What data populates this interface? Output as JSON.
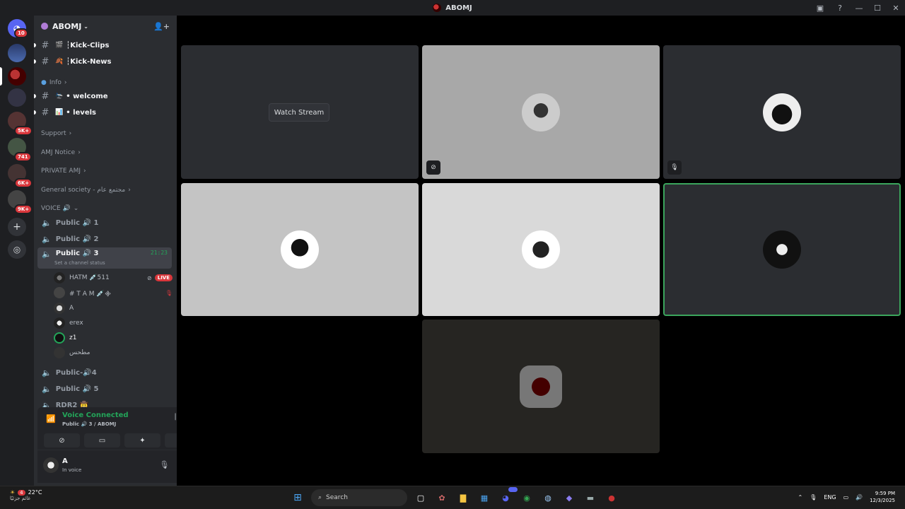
{
  "window": {
    "title": "ABOMJ"
  },
  "guilds": {
    "home_badge": "10",
    "badges": [
      "5K+",
      "741",
      "6K+",
      "9K+"
    ]
  },
  "server": {
    "name": "ABOMJ"
  },
  "channels": {
    "text_top": [
      {
        "emoji": "🎬",
        "name": "┆Kick-Clips"
      },
      {
        "emoji": "🍂",
        "name": "┆Kick-News"
      }
    ],
    "info_category": "Info",
    "info_channels": [
      {
        "emoji": "🛬",
        "name": "• welcome"
      },
      {
        "emoji": "📊",
        "name": "• levels"
      }
    ],
    "categories": [
      "Support",
      "AMJ Notice",
      "PRIVATE AMJ",
      "General society - مجتمع عام"
    ],
    "voice_category": "VOICE 🔊",
    "voice_before": [
      {
        "name": "Public 🔊 1"
      },
      {
        "name": "Public 🔊 2"
      }
    ],
    "active_voice": {
      "name": "Public 🔊 3",
      "timer": "21:23",
      "status": "Set a channel status"
    },
    "voice_users": [
      {
        "name": "HATM 💉511",
        "live": "LIVE"
      },
      {
        "name": "# T A M 💉᯽"
      },
      {
        "name": "A"
      },
      {
        "name": "erex"
      },
      {
        "name": "z1"
      },
      {
        "name": "مطحس"
      }
    ],
    "voice_after": [
      {
        "name": "Public-🔊4"
      },
      {
        "name": "Public 🔊 5"
      },
      {
        "name": "RDR2 🤠"
      }
    ]
  },
  "voice_panel": {
    "status": "Voice Connected",
    "sub": "Public 🔊 3 / ABOMJ"
  },
  "user_panel": {
    "name": "A",
    "status": "In voice"
  },
  "stage": {
    "watch_label": "Watch Stream"
  },
  "taskbar": {
    "weather_temp": "22°C",
    "weather_desc": "غائم جزئيًا",
    "search": "Search",
    "lang": "ENG",
    "time": "9:59 PM",
    "date": "12/3/2025",
    "notif_count": "4",
    "discord_badge": "9+"
  },
  "colors": {
    "accent_green": "#23a559",
    "danger": "#da373c",
    "sidebar": "#2b2d31"
  }
}
